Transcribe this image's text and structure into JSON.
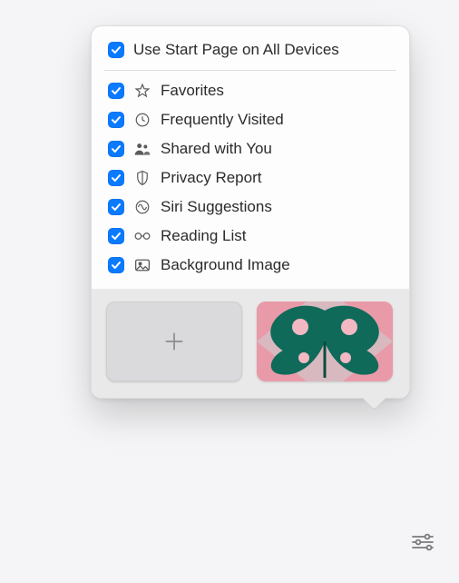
{
  "colors": {
    "accent": "#0a7aff",
    "panel_bg": "#fdfdfd",
    "thumb_bg": "#e9e9ea"
  },
  "header": {
    "label": "Use Start Page on All Devices",
    "checked": true
  },
  "options": [
    {
      "id": "favorites",
      "label": "Favorites",
      "icon": "star-icon",
      "checked": true
    },
    {
      "id": "frequent",
      "label": "Frequently Visited",
      "icon": "clock-icon",
      "checked": true
    },
    {
      "id": "shared",
      "label": "Shared with You",
      "icon": "people-icon",
      "checked": true
    },
    {
      "id": "privacy",
      "label": "Privacy Report",
      "icon": "shield-icon",
      "checked": true
    },
    {
      "id": "siri",
      "label": "Siri Suggestions",
      "icon": "siri-icon",
      "checked": true
    },
    {
      "id": "readinglist",
      "label": "Reading List",
      "icon": "glasses-icon",
      "checked": true
    },
    {
      "id": "background",
      "label": "Background Image",
      "icon": "image-icon",
      "checked": true
    }
  ],
  "thumbnails": {
    "add_label": "+",
    "preset_name": "butterfly-wallpaper"
  },
  "settings_button": {
    "name": "customize-start-page"
  }
}
